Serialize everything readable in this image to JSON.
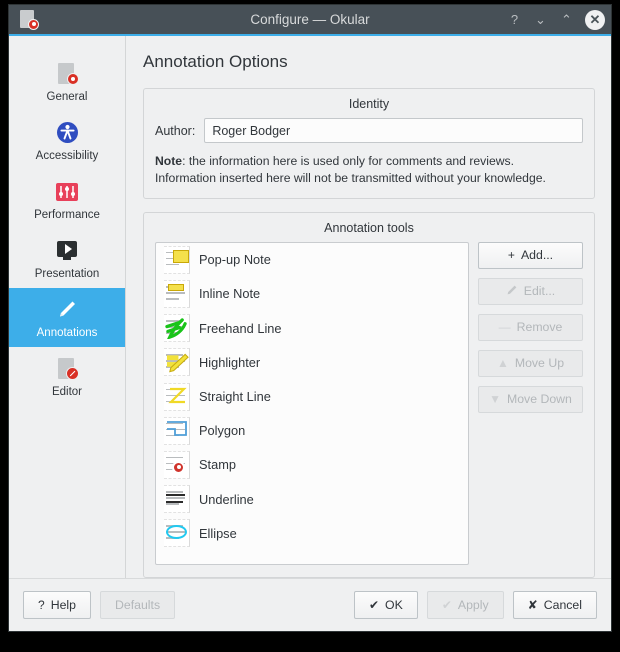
{
  "window": {
    "title": "Configure — Okular",
    "app_icon": "okular-document-icon",
    "controls": {
      "help": "?",
      "shade": "⌄",
      "maximize": "⌃",
      "close": "✕"
    }
  },
  "sidebar": {
    "items": [
      {
        "label": "General",
        "icon": "document-eye-icon",
        "selected": false
      },
      {
        "label": "Accessibility",
        "icon": "accessibility-icon",
        "selected": false
      },
      {
        "label": "Performance",
        "icon": "sliders-icon",
        "selected": false
      },
      {
        "label": "Presentation",
        "icon": "screen-play-icon",
        "selected": false
      },
      {
        "label": "Annotations",
        "icon": "pencil-icon",
        "selected": true
      },
      {
        "label": "Editor",
        "icon": "document-edit-icon",
        "selected": false
      }
    ]
  },
  "main": {
    "page_title": "Annotation Options",
    "identity": {
      "group_title": "Identity",
      "author_label": "Author:",
      "author_value": "Roger Bodger",
      "author_placeholder": "",
      "note_prefix": "Note",
      "note_line1": ": the information here is used only for comments and reviews.",
      "note_line2": "Information inserted here will not be transmitted without your knowledge."
    },
    "tools": {
      "group_title": "Annotation tools",
      "items": [
        {
          "label": "Pop-up Note",
          "icon": "popup-note-icon"
        },
        {
          "label": "Inline Note",
          "icon": "inline-note-icon"
        },
        {
          "label": "Freehand Line",
          "icon": "freehand-line-icon"
        },
        {
          "label": "Highlighter",
          "icon": "highlighter-icon"
        },
        {
          "label": "Straight Line",
          "icon": "straight-line-icon"
        },
        {
          "label": "Polygon",
          "icon": "polygon-icon"
        },
        {
          "label": "Stamp",
          "icon": "stamp-icon"
        },
        {
          "label": "Underline",
          "icon": "underline-icon"
        },
        {
          "label": "Ellipse",
          "icon": "ellipse-icon"
        }
      ],
      "buttons": [
        {
          "label": "Add...",
          "glyph": "+",
          "icon": "plus-icon",
          "enabled": true
        },
        {
          "label": "Edit...",
          "glyph": "",
          "icon": "pencil-icon",
          "enabled": false
        },
        {
          "label": "Remove",
          "glyph": "—",
          "icon": "minus-icon",
          "enabled": false
        },
        {
          "label": "Move Up",
          "glyph": "▲",
          "icon": "arrow-up-icon",
          "enabled": false
        },
        {
          "label": "Move Down",
          "glyph": "▼",
          "icon": "arrow-down-icon",
          "enabled": false
        }
      ]
    }
  },
  "footer": {
    "help": {
      "label": "Help",
      "glyph": "?",
      "icon": "question-icon",
      "enabled": true
    },
    "defaults": {
      "label": "Defaults",
      "glyph": "",
      "icon": "",
      "enabled": false
    },
    "ok": {
      "label": "OK",
      "glyph": "✔",
      "icon": "check-icon",
      "enabled": true
    },
    "apply": {
      "label": "Apply",
      "glyph": "✔",
      "icon": "check-icon",
      "enabled": false
    },
    "cancel": {
      "label": "Cancel",
      "glyph": "✘",
      "icon": "cross-icon",
      "enabled": true
    }
  },
  "colors": {
    "titlebar": "#475057",
    "accent": "#3daee9",
    "window_bg": "#eff0f1",
    "text": "#31363b",
    "field_bg": "#fcfcfc"
  }
}
